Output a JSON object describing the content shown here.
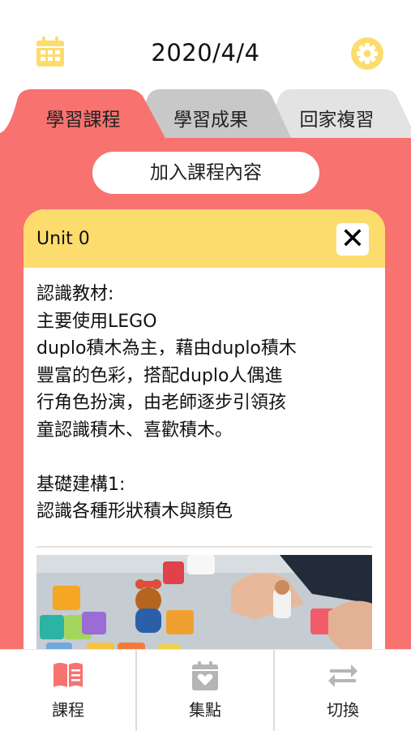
{
  "header": {
    "date": "2020/4/4",
    "calendar_icon": "calendar-icon",
    "settings_icon": "gear-icon",
    "accent_color": "#fddc6e"
  },
  "tabs": [
    {
      "label": "學習課程",
      "active": true,
      "color": "#f8726f"
    },
    {
      "label": "學習成果",
      "active": false,
      "color": "#c8c8c8"
    },
    {
      "label": "回家複習",
      "active": false,
      "color": "#e3e3e3"
    }
  ],
  "main": {
    "background": "#f8726f",
    "add_button_label": "加入課程內容"
  },
  "card": {
    "title": "Unit 0",
    "close_icon": "close-icon",
    "header_color": "#fddc6e",
    "lines": [
      "認識教材:",
      "主要使用LEGO",
      "duplo積木為主，藉由duplo積木",
      "豐富的色彩，搭配duplo人偶進",
      "行角色扮演，由老師逐步引領孩",
      "童認識積木、喜歡積木。",
      "",
      "基礎建構1:",
      "認識各種形狀積木與顏色"
    ]
  },
  "bottom_nav": [
    {
      "label": "課程",
      "icon": "book-icon",
      "active": true,
      "icon_color": "#f8726f"
    },
    {
      "label": "集點",
      "icon": "stamp-card-icon",
      "active": false,
      "icon_color": "#b5b5b5"
    },
    {
      "label": "切換",
      "icon": "switch-arrows-icon",
      "active": false,
      "icon_color": "#b5b5b5"
    }
  ]
}
